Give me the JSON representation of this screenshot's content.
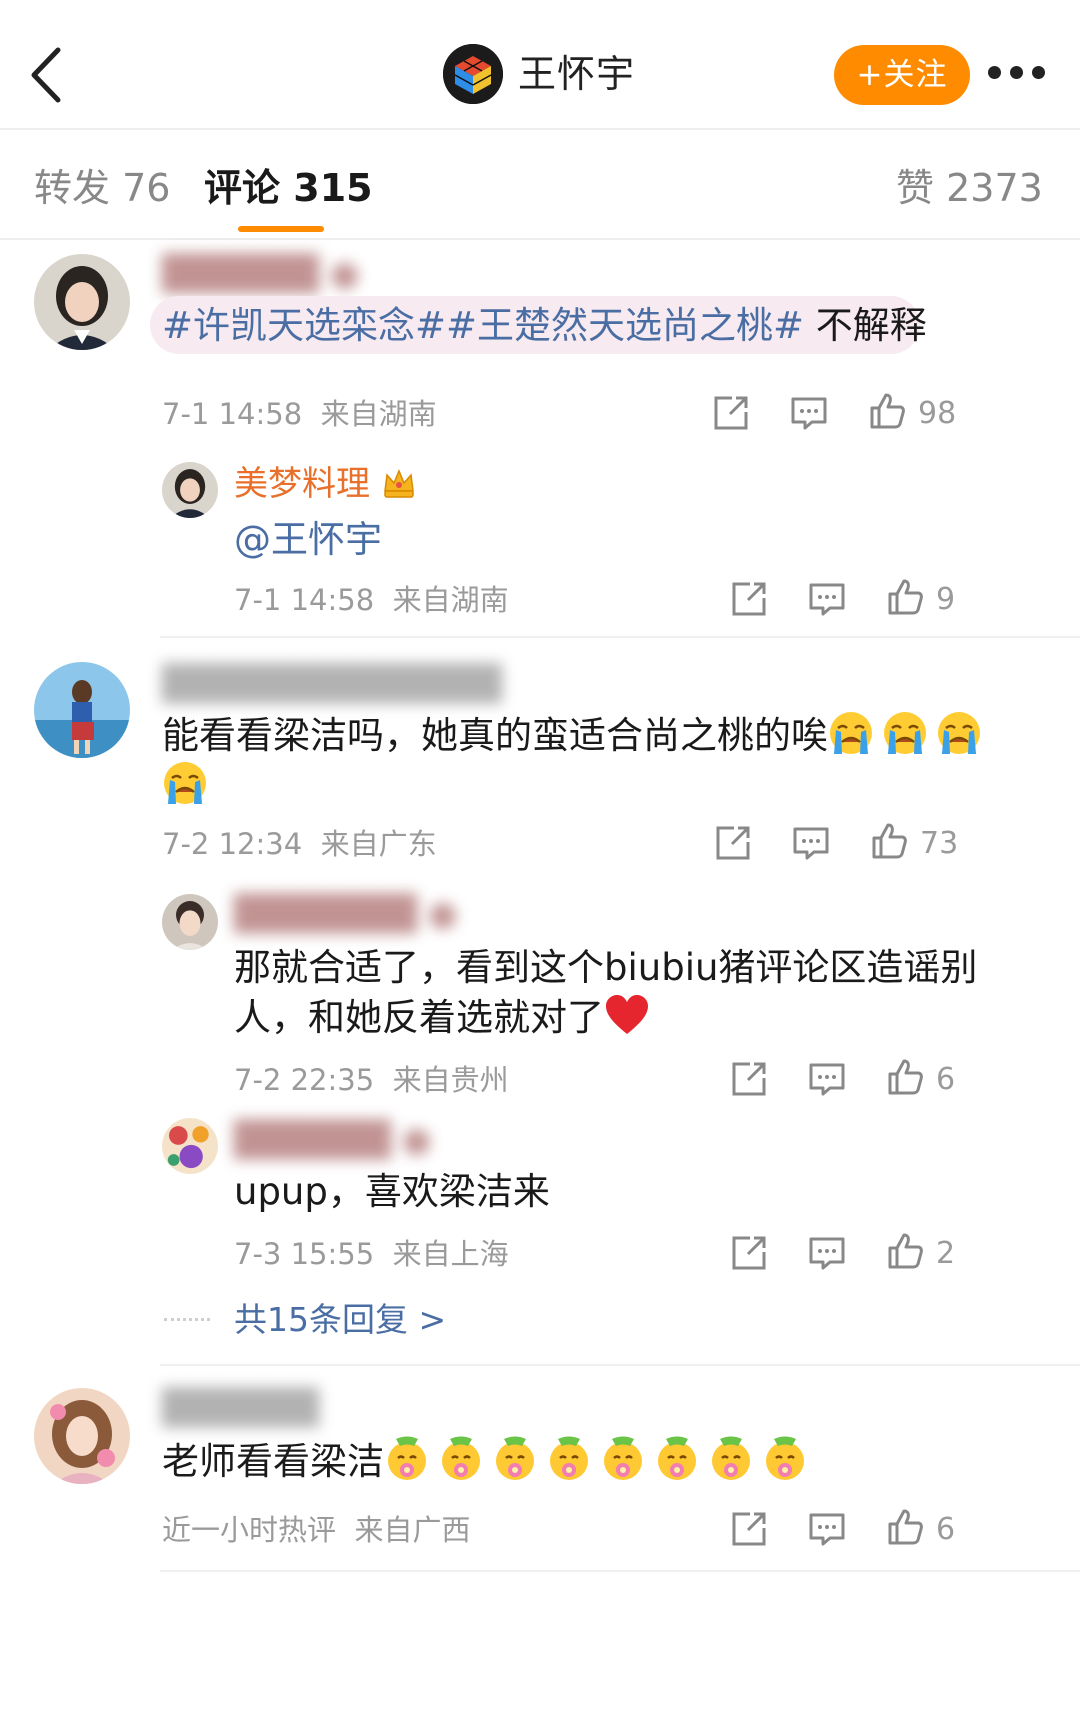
{
  "header": {
    "title": "王怀宇",
    "follow_label": "+关注"
  },
  "tabs": {
    "repost_label": "转发",
    "repost_count": "76",
    "comment_label": "评论",
    "comment_count": "315",
    "like_label": "赞",
    "like_count": "2373"
  },
  "colors": {
    "accent": "#ff8c00",
    "link": "#4a6ea3",
    "meta": "#9a9a9a",
    "vip_name": "#e8702a"
  },
  "comments": [
    {
      "text_topic": "#许凯天选栾念##王楚然天选尚之桃#",
      "text_rest": " 不解释",
      "time": "7-1 14:58",
      "location": "来自湖南",
      "likes": "98",
      "replies": [
        {
          "username": "美梦料理",
          "text": "@王怀宇",
          "time": "7-1 14:58",
          "location": "来自湖南",
          "likes": "9"
        }
      ]
    },
    {
      "text_line1": "能看看梁洁吗，她真的蛮适合尚之桃的唉",
      "time": "7-2 12:34",
      "location": "来自广东",
      "likes": "73",
      "replies": [
        {
          "text_line1": "那就合适了，看到这个biubiu猪评论区造谣别",
          "text_line2": "人，和她反着选就对了",
          "time": "7-2 22:35",
          "location": "来自贵州",
          "likes": "6"
        },
        {
          "text": "upup，喜欢梁洁来",
          "time": "7-3 15:55",
          "location": "来自上海",
          "likes": "2"
        }
      ],
      "more_replies": "共15条回复 >"
    },
    {
      "text": "老师看看梁洁",
      "time": "近一小时热评",
      "location": "来自广西",
      "likes": "6"
    }
  ]
}
